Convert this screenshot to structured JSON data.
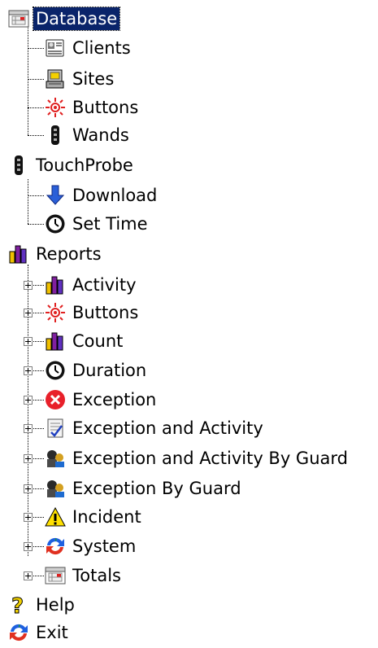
{
  "tree": {
    "database": {
      "label": "Database",
      "selected": true,
      "children": [
        {
          "label": "Clients",
          "icon": "clients-icon"
        },
        {
          "label": "Sites",
          "icon": "sites-icon"
        },
        {
          "label": "Buttons",
          "icon": "buttons-icon"
        },
        {
          "label": "Wands",
          "icon": "wand-icon"
        }
      ]
    },
    "touchprobe": {
      "label": "TouchProbe",
      "children": [
        {
          "label": "Download",
          "icon": "download-arrow-icon"
        },
        {
          "label": "Set Time",
          "icon": "clock-icon"
        }
      ]
    },
    "reports": {
      "label": "Reports",
      "children": [
        {
          "label": "Activity",
          "icon": "bar-chart-icon"
        },
        {
          "label": "Buttons",
          "icon": "buttons-icon"
        },
        {
          "label": "Count",
          "icon": "bar-chart-icon"
        },
        {
          "label": "Duration",
          "icon": "clock-icon"
        },
        {
          "label": "Exception",
          "icon": "error-icon"
        },
        {
          "label": "Exception and Activity",
          "icon": "checklist-icon"
        },
        {
          "label": "Exception and Activity By Guard",
          "icon": "guard-icon"
        },
        {
          "label": "Exception By Guard",
          "icon": "guard-icon"
        },
        {
          "label": "Incident",
          "icon": "warning-icon"
        },
        {
          "label": "System",
          "icon": "system-arrows-icon"
        },
        {
          "label": "Totals",
          "icon": "calendar-icon"
        }
      ]
    },
    "help": {
      "label": "Help"
    },
    "exit": {
      "label": "Exit"
    }
  }
}
